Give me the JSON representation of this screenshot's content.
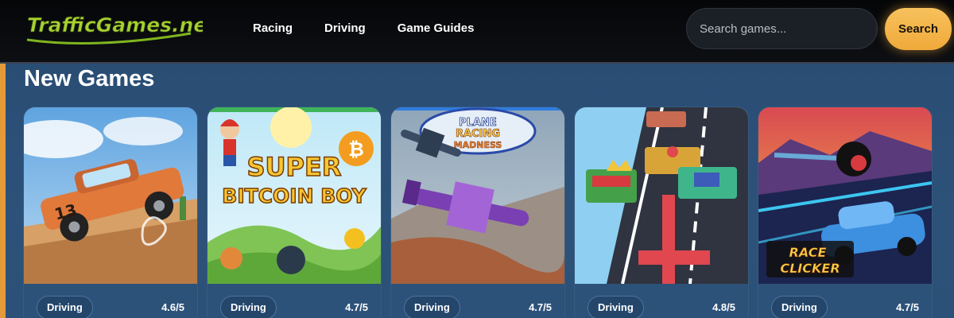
{
  "header": {
    "logo_text": "TrafficGames.net",
    "nav": [
      "Racing",
      "Driving",
      "Game Guides"
    ],
    "search": {
      "placeholder": "Search games...",
      "button_label": "Search"
    }
  },
  "main": {
    "title": "New Games",
    "cards": [
      {
        "tag": "Driving",
        "rating": "4.6/5",
        "art_text": "13"
      },
      {
        "tag": "Driving",
        "rating": "4.7/5",
        "art_text_line1": "SUPER",
        "art_text_line2": "BITCOIN BOY",
        "coin_symbol": "₿"
      },
      {
        "tag": "Driving",
        "rating": "4.7/5",
        "art_text_line1": "PLANE",
        "art_text_line2": "RACING",
        "art_text_line3": "MADNESS"
      },
      {
        "tag": "Driving",
        "rating": "4.8/5"
      },
      {
        "tag": "Driving",
        "rating": "4.7/5",
        "art_text_line1": "RACE",
        "art_text_line2": "CLICKER"
      }
    ]
  },
  "colors": {
    "accent_orange": "#f0a93a",
    "page_blue": "#2a4d74",
    "logo_green": "#9ccc2a"
  }
}
